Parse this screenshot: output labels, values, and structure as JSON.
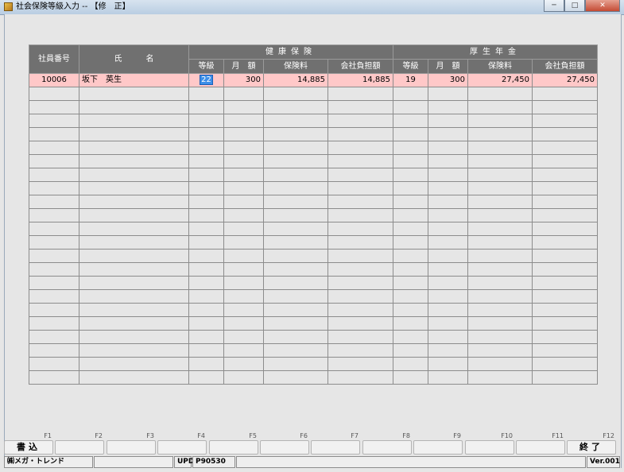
{
  "window": {
    "title": "社会保険等級入力 -- 【修　正】",
    "minimize": "─",
    "maximize": "□",
    "close": "✕"
  },
  "grid": {
    "headers": {
      "employee_no": "社員番号",
      "name": "氏　　　名",
      "health": "健康保険",
      "pension": "厚生年金",
      "grade": "等級",
      "monthly": "月　額",
      "premium": "保険料",
      "company": "会社負担額"
    },
    "rows": [
      {
        "employee_no": "10006",
        "name": "坂下　英生",
        "health_grade": "22",
        "health_monthly": "300",
        "health_premium": "14,885",
        "health_company": "14,885",
        "pension_grade": "19",
        "pension_monthly": "300",
        "pension_premium": "27,450",
        "pension_company": "27,450"
      }
    ]
  },
  "fkeys": [
    {
      "key": "F1",
      "label": "書込"
    },
    {
      "key": "F2",
      "label": ""
    },
    {
      "key": "F3",
      "label": ""
    },
    {
      "key": "F4",
      "label": ""
    },
    {
      "key": "F5",
      "label": ""
    },
    {
      "key": "F6",
      "label": ""
    },
    {
      "key": "F7",
      "label": ""
    },
    {
      "key": "F8",
      "label": ""
    },
    {
      "key": "F9",
      "label": ""
    },
    {
      "key": "F10",
      "label": ""
    },
    {
      "key": "F11",
      "label": ""
    },
    {
      "key": "F12",
      "label": "終了"
    }
  ],
  "status": {
    "company": "㈱メガ・トレンド",
    "mode": "UPD",
    "program": "P90530",
    "version": "Ver.001"
  }
}
